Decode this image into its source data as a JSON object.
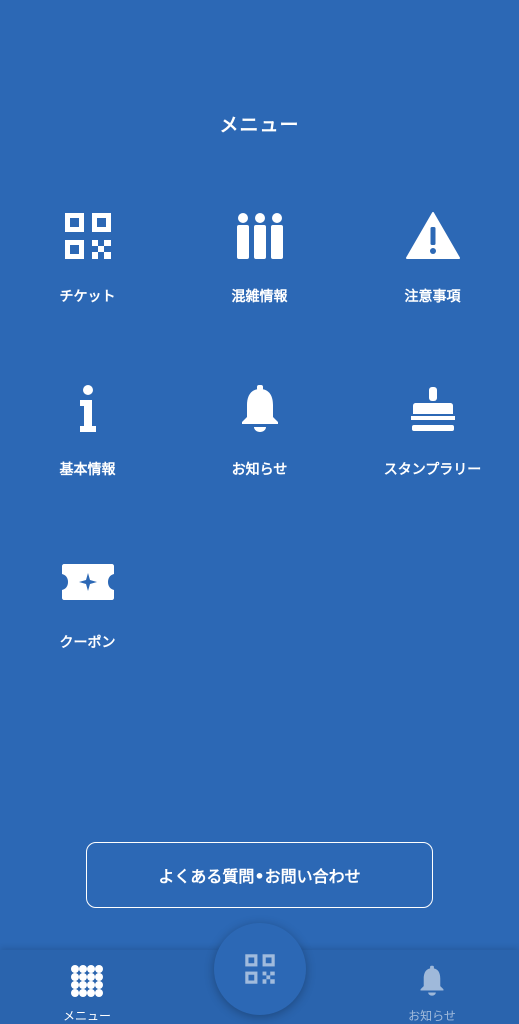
{
  "header": {
    "title": "メニュー"
  },
  "menu": {
    "items": [
      {
        "label": "チケット",
        "icon": "qr-code-icon"
      },
      {
        "label": "混雑情報",
        "icon": "crowd-people-icon"
      },
      {
        "label": "注意事項",
        "icon": "warning-icon"
      },
      {
        "label": "基本情報",
        "icon": "info-icon"
      },
      {
        "label": "お知らせ",
        "icon": "bell-icon"
      },
      {
        "label": "スタンプラリー",
        "icon": "stamp-icon"
      },
      {
        "label": "クーポン",
        "icon": "coupon-icon"
      }
    ]
  },
  "faq": {
    "label": "よくある質問•お問い合わせ"
  },
  "bottom_nav": {
    "items": [
      {
        "label": "メニュー",
        "icon": "grid-dots-icon",
        "active": true
      },
      {
        "label": "",
        "icon": "qr-code-icon"
      },
      {
        "label": "お知らせ",
        "icon": "bell-icon",
        "active": false
      }
    ]
  },
  "colors": {
    "background": "#2c68b5",
    "foreground": "#ffffff"
  }
}
